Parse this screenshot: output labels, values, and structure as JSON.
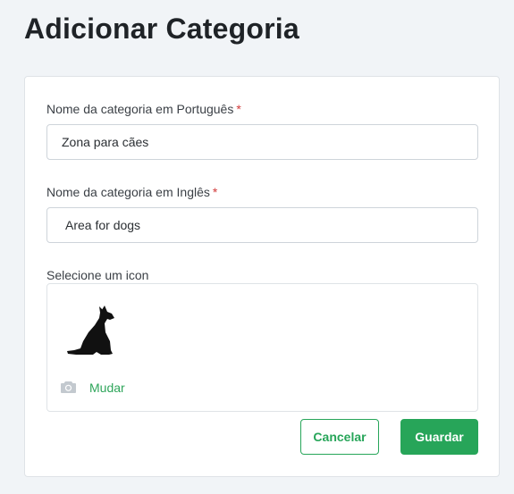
{
  "page": {
    "title": "Adicionar Categoria"
  },
  "form": {
    "name_pt": {
      "label": "Nome da categoria em Português",
      "required_mark": "*",
      "value": "Zona para cães"
    },
    "name_en": {
      "label": "Nome da categoria em Inglês",
      "required_mark": "*",
      "value": "Area for dogs"
    },
    "icon": {
      "label": "Selecione um icon",
      "selected_icon": "dog-sitting-icon",
      "change_icon": "camera-icon",
      "change_label": "Mudar"
    }
  },
  "actions": {
    "cancel_label": "Cancelar",
    "save_label": "Guardar"
  },
  "colors": {
    "accent": "#27a559",
    "required": "#d23b3b",
    "background": "#f1f4f7"
  }
}
